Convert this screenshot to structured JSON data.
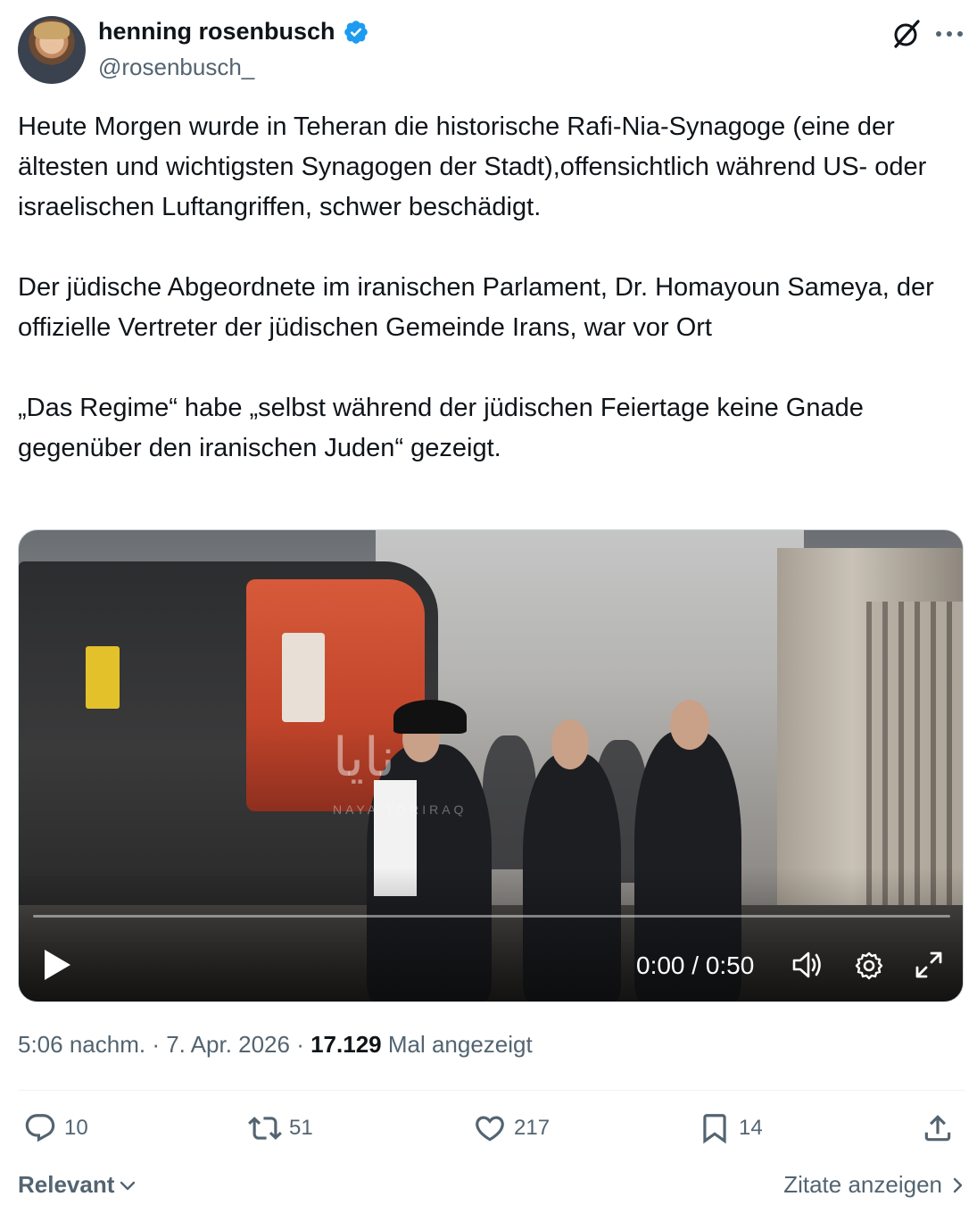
{
  "author": {
    "name": "henning rosenbusch",
    "handle": "@rosenbusch_"
  },
  "tweet": {
    "text": "Heute Morgen wurde in Teheran die historische Rafi-Nia-Synagoge (eine der ältesten und wichtigsten Synagogen der Stadt),offensichtlich während US- oder israelischen Luftangriffen, schwer beschädigt.\n\nDer jüdische Abgeordnete im iranischen Parlament, Dr. Homayoun Sameya, der offizielle Vertreter der jüdischen Gemeinde Irans, war vor Ort\n\n„Das Regime“ habe „selbst während der jüdischen Feiertage keine Gnade gegenüber den iranischen Juden“ gezeigt."
  },
  "video": {
    "time": "0:00 / 0:50",
    "watermark": "نایا",
    "watermark_sub": "NAYA TORIRAQ"
  },
  "meta": {
    "time_date": "5:06 nachm. · 7. Apr. 2026 · ",
    "views": "17.129",
    "views_label": " Mal angezeigt"
  },
  "actions": {
    "replies": "10",
    "reposts": "51",
    "likes": "217",
    "bookmarks": "14"
  },
  "footer": {
    "relevant": "Relevant",
    "quotes": "Zitate anzeigen"
  },
  "colors": {
    "verified": "#1d9bf0",
    "secondary_text": "#536471",
    "primary_text": "#0f1419"
  }
}
